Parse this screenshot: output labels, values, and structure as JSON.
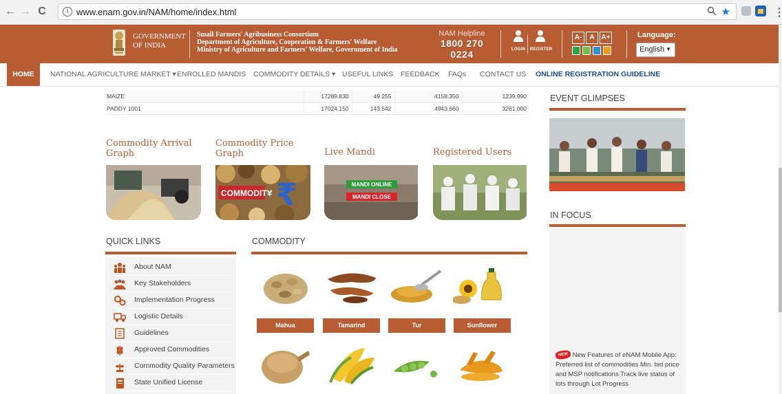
{
  "browser": {
    "url": "www.enam.gov.in/NAM/home/index.html",
    "back_glyph": "←",
    "forward_glyph": "→",
    "reload_glyph": "C",
    "info_glyph": "i",
    "zoom_glyph": "🔍",
    "star_glyph": "★",
    "menu_glyph": "⋮"
  },
  "header": {
    "gov_line1": "GOVERNMENT",
    "gov_line2": "OF INDIA",
    "sfac_line1": "Small Farmers' Agribusiness Consortium",
    "sfac_line2": "Department of Agriculture, Cooperation & Farmers' Welfare",
    "sfac_line3": "Ministry of Agriculture and Farmers' Welfare, Government of India",
    "helpline_label": "NAM Helpline",
    "helpline_number": "1800 270 0224",
    "login_label": "LOGIN",
    "register_label": "REGISTER",
    "font_small": "A-",
    "font_normal": "A",
    "font_large": "A+",
    "language_label": "Language:",
    "language_value": "English",
    "language_caret": "▼",
    "theme_colors": [
      "#2aa64b",
      "#6fc04d",
      "#2d8fd6",
      "#f39a1e"
    ]
  },
  "nav": {
    "home": "HOME",
    "nam": "NATIONAL AGRICULTURE MARKET ▾",
    "mandis": "ENROLLED MANDIS",
    "commodity": "COMMODITY DETAILS ▾",
    "links": "USEFUL LINKS",
    "feedback": "FEEDBACK",
    "faqs": "FAQs",
    "contact": "CONTACT US",
    "registration": "ONLINE REGISTRATION GUIDELINE"
  },
  "table": {
    "rows": [
      {
        "name": "MAIZE",
        "c1": "17289.830",
        "c2": "49.255",
        "c3": "4158.350",
        "c4": "1239.990"
      },
      {
        "name": "PADDY 1001",
        "c1": "17024.150",
        "c2": "143.542",
        "c3": "4943.660",
        "c4": "3261.000"
      }
    ]
  },
  "tiles": {
    "arrival_l1": "Commodity Arrival",
    "arrival_l2": "Graph",
    "price_l1": "Commodity Price",
    "price_l2": "Graph",
    "mandi": "Live Mandi",
    "users": "Registered Users",
    "commodity_banner": "COMMODITY",
    "mandi_online": "MANDI ONLINE",
    "mandi_close": "MANDI CLOSE"
  },
  "quick_links": {
    "title": "QUICK LINKS",
    "items": [
      "About NAM",
      "Key Stakeholders",
      "Implementation Progress",
      "Logistic Details",
      "Guidelines",
      "Approved Commodities",
      "Commodity Quality Parameters",
      "State Unified License"
    ]
  },
  "commodity": {
    "title": "COMMODITY",
    "items": [
      "Mahua",
      "Tamarind",
      "Tur",
      "Sunflower"
    ]
  },
  "right": {
    "events_title": "EVENT GLIMPSES",
    "focus_title": "IN FOCUS",
    "new_badge": "NEW",
    "focus_text": "New Features of eNAM Mobile App: Preferred list of commodities Min. bid price and MSP notifications Track live status of lots through Lot Progress"
  },
  "colors": {
    "brand": "#b85c34",
    "nav_link": "#1a4a9c"
  }
}
